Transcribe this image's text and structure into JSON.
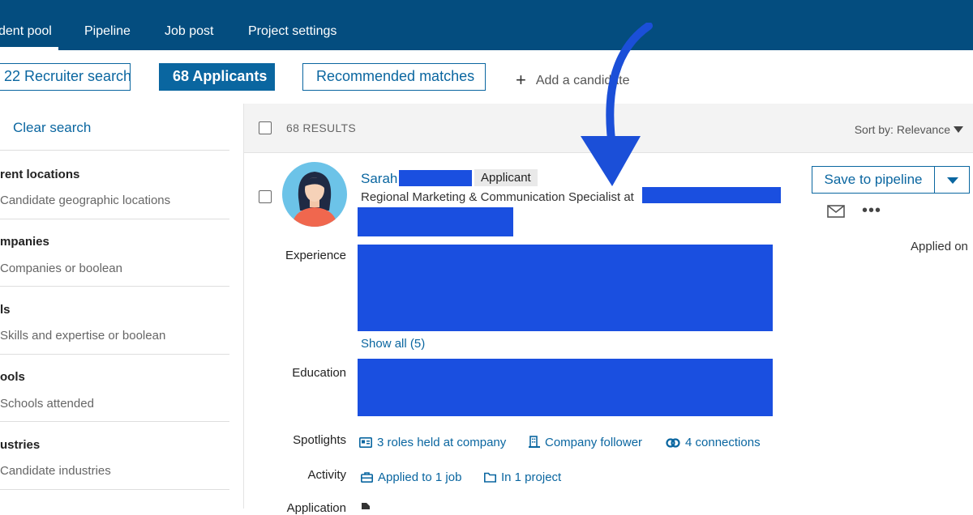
{
  "nav": {
    "tabs": [
      {
        "label": "dent pool",
        "active": true
      },
      {
        "label": "Pipeline"
      },
      {
        "label": "Job post"
      },
      {
        "label": "Project settings"
      }
    ]
  },
  "toolbar": {
    "recruiter_search": "22 Recruiter search",
    "applicants": "68 Applicants",
    "recommended": "Recommended matches",
    "add_candidate": "Add a candidate"
  },
  "sidebar": {
    "clear_search": "Clear search",
    "filters": [
      {
        "title": "rent locations",
        "sub": "Candidate geographic locations"
      },
      {
        "title": "mpanies",
        "sub": "Companies or boolean"
      },
      {
        "title": "ls",
        "sub": "Skills and expertise or boolean"
      },
      {
        "title": "ools",
        "sub": "Schools attended"
      },
      {
        "title": "ustries",
        "sub": "Candidate industries"
      }
    ]
  },
  "results": {
    "count": "68 RESULTS",
    "sort": "Sort by: Relevance"
  },
  "candidate": {
    "name": "Sarah",
    "badge": "Applicant",
    "headline": "Regional Marketing & Communication Specialist at",
    "labels": {
      "experience": "Experience",
      "education": "Education",
      "spotlights": "Spotlights",
      "activity": "Activity",
      "application": "Application"
    },
    "show_all": "Show all (5)",
    "spotlights": [
      {
        "label": "3 roles held at company",
        "icon": "id-card-icon"
      },
      {
        "label": "Company follower",
        "icon": "building-icon"
      },
      {
        "label": "4 connections",
        "icon": "connections-icon"
      }
    ],
    "activity": [
      {
        "label": "Applied to 1 job",
        "icon": "briefcase-icon"
      },
      {
        "label": "In 1 project",
        "icon": "folder-icon"
      }
    ],
    "actions": {
      "save": "Save to pipeline",
      "applied_on": "Applied on"
    }
  },
  "colors": {
    "nav_bg": "#044d7f",
    "accent": "#0a66a0",
    "redaction": "#1a4fe0",
    "arrow": "#1b4fd8"
  }
}
